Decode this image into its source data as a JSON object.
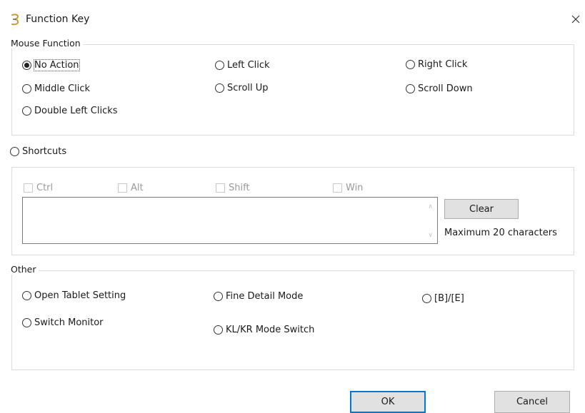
{
  "window": {
    "title": "Function Key"
  },
  "mouse_function": {
    "label": "Mouse Function",
    "options": [
      "No Action",
      "Left Click",
      "Right Click",
      "Middle Click",
      "Scroll Up",
      "Scroll Down",
      "Double Left Clicks"
    ]
  },
  "shortcuts": {
    "label": "Shortcuts",
    "modifiers": [
      "Ctrl",
      "Alt",
      "Shift",
      "Win"
    ],
    "input_value": "",
    "clear_label": "Clear",
    "hint": "Maximum 20 characters"
  },
  "other": {
    "label": "Other",
    "options": [
      "Open Tablet Setting",
      "Fine Detail Mode",
      "[B]/[E]",
      "Switch Monitor",
      "KL/KR Mode Switch"
    ]
  },
  "buttons": {
    "ok": "OK",
    "cancel": "Cancel"
  },
  "icons": {
    "app": "app-logo-icon",
    "close": "close-icon"
  },
  "colors": {
    "accent": "#0078d7",
    "button_face": "#e1e1e1",
    "group_border": "#dcdcdc",
    "disabled_text": "#9a9a9a"
  }
}
